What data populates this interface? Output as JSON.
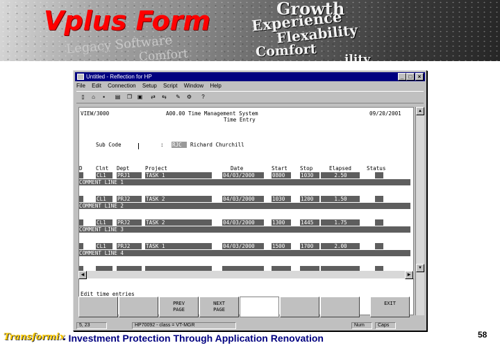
{
  "slide": {
    "title": "Vplus Form",
    "banner_words": [
      "Growth",
      "Experience",
      "Flexability",
      "Comfort",
      "Legacy Software",
      "Comfort",
      "ility"
    ],
    "brand": "Transformix",
    "tagline": "- Investment Protection Through Application Renovation",
    "page_number": "58",
    "colors": {
      "title": "#ff0000",
      "brand": "#ffcc00",
      "tagline": "#000080"
    }
  },
  "window": {
    "title": "Untitled - Reflection for HP",
    "menu": [
      "File",
      "Edit",
      "Connection",
      "Setup",
      "Script",
      "Window",
      "Help"
    ],
    "toolbar_icons": [
      "new-icon",
      "open-icon",
      "save-icon",
      "print-icon",
      "copy-icon",
      "paste-icon",
      "connect-icon",
      "disconnect-icon",
      "macro-icon",
      "settings-icon",
      "help-icon"
    ],
    "buttons": {
      "minimize": "_",
      "maximize": "□",
      "close": "×"
    }
  },
  "terminal": {
    "header_left": "VIEW/3000",
    "header_center": "A00.00 Time Management System",
    "header_sub": "Time Entry",
    "header_date": "09/20/2001",
    "subcode_label": "Sub Code",
    "subcode_colon": ":",
    "subcode_value": "RJC",
    "subcode_name": "Richard Churchill",
    "columns": [
      "D",
      "Clnt",
      "Dept",
      "Project",
      "Date",
      "Start",
      "Stop",
      "Elapsed",
      "Status"
    ],
    "rows": [
      {
        "clnt": "CL1",
        "dept": "PRJ1",
        "project": "TASK 1",
        "date": "04/03/2000",
        "start": "0800",
        "stop": "1030",
        "elapsed": "2.50",
        "comment": "COMMENT LINE 1"
      },
      {
        "clnt": "CL1",
        "dept": "PRJ2",
        "project": "TASK 2",
        "date": "04/03/2000",
        "start": "1030",
        "stop": "1200",
        "elapsed": "1.50",
        "comment": "COMMENT LINE 2"
      },
      {
        "clnt": "CL1",
        "dept": "PRJ2",
        "project": "TASK 2",
        "date": "04/03/2000",
        "start": "1300",
        "stop": "1445",
        "elapsed": "1.75",
        "comment": "COMMENT LINE 3"
      },
      {
        "clnt": "CL1",
        "dept": "PRJ2",
        "project": "TASK 1",
        "date": "04/03/2000",
        "start": "1500",
        "stop": "1700",
        "elapsed": "2.00",
        "comment": "COMMENT LINE 4"
      }
    ],
    "message": "Edit time entries",
    "function_keys": [
      "",
      "",
      "PREV\nPAGE",
      "NEXT\nPAGE",
      "",
      "",
      "",
      "EXIT"
    ]
  },
  "statusbar": {
    "cursor": "5, 23",
    "host": "HP70092 - class = VT-MGR",
    "num": "Num",
    "caps": "Caps"
  }
}
